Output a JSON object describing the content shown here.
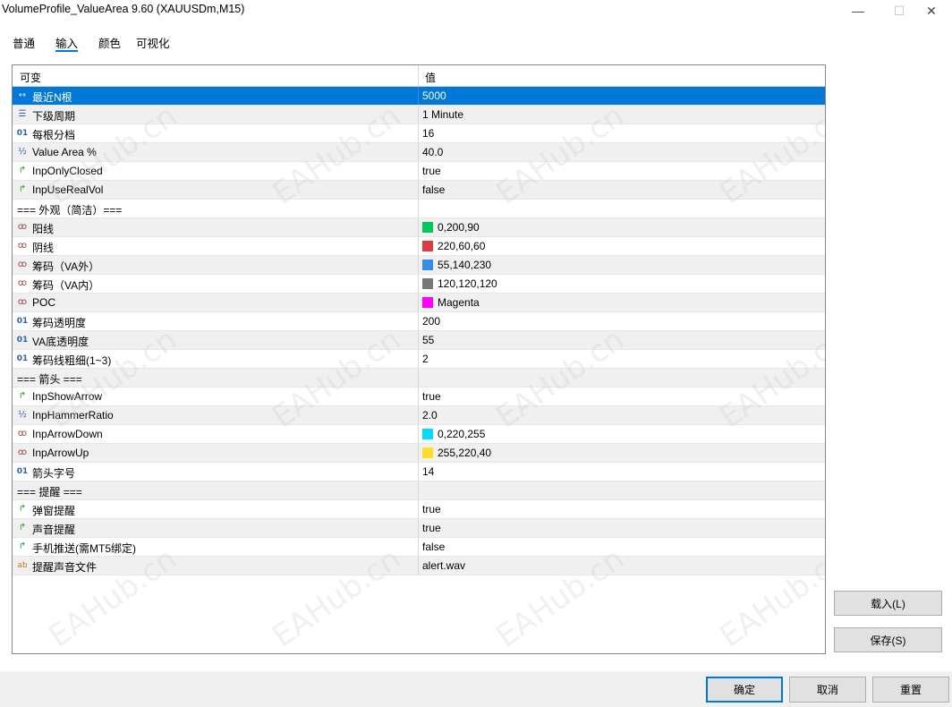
{
  "window": {
    "title": "VolumeProfile_ValueArea 9.60 (XAUUSDm,M15)",
    "min_glyph": "—",
    "max_glyph": "☐",
    "close_glyph": "✕"
  },
  "tabs": [
    {
      "label": "普通"
    },
    {
      "label": "输入",
      "active": true
    },
    {
      "label": "颜色"
    },
    {
      "label": "可视化"
    }
  ],
  "grid": {
    "col_variable": "可变",
    "col_value": "值",
    "rows": [
      {
        "icon": "ruler-icon",
        "glyph": "↔",
        "name": "最近N根",
        "value": "5000",
        "selected": true
      },
      {
        "icon": "enum-icon",
        "glyph": "☰",
        "name": "下级周期",
        "value": "1 Minute"
      },
      {
        "icon": "int-icon",
        "glyph": "01",
        "name": "每根分档",
        "value": "16"
      },
      {
        "icon": "double-icon",
        "glyph": "½",
        "name": "Value Area %",
        "value": "40.0"
      },
      {
        "icon": "bool-icon",
        "glyph": "↱",
        "name": "InpOnlyClosed",
        "value": "true"
      },
      {
        "icon": "bool-icon",
        "glyph": "↱",
        "name": "InpUseRealVol",
        "value": "false"
      },
      {
        "section": true,
        "name": "=== 外观（简洁）===",
        "value": ""
      },
      {
        "icon": "color-icon",
        "glyph": "ꝏ",
        "name": "阳线",
        "value": "0,200,90",
        "swatch": "#00c85a"
      },
      {
        "icon": "color-icon",
        "glyph": "ꝏ",
        "name": "阴线",
        "value": "220,60,60",
        "swatch": "#dc3c3c"
      },
      {
        "icon": "color-icon",
        "glyph": "ꝏ",
        "name": "筹码（VA外）",
        "value": "55,140,230",
        "swatch": "#378ce6"
      },
      {
        "icon": "color-icon",
        "glyph": "ꝏ",
        "name": "筹码（VA内）",
        "value": "120,120,120",
        "swatch": "#787878"
      },
      {
        "icon": "color-icon",
        "glyph": "ꝏ",
        "name": "POC",
        "value": "Magenta",
        "swatch": "#ff00ff"
      },
      {
        "icon": "int-icon",
        "glyph": "01",
        "name": "筹码透明度",
        "value": "200"
      },
      {
        "icon": "int-icon",
        "glyph": "01",
        "name": "VA底透明度",
        "value": "55"
      },
      {
        "icon": "int-icon",
        "glyph": "01",
        "name": "筹码线粗细(1~3)",
        "value": "2"
      },
      {
        "section": true,
        "name": "=== 箭头 ===",
        "value": ""
      },
      {
        "icon": "bool-icon",
        "glyph": "↱",
        "name": "InpShowArrow",
        "value": "true"
      },
      {
        "icon": "double-icon",
        "glyph": "½",
        "name": "InpHammerRatio",
        "value": "2.0"
      },
      {
        "icon": "color-icon",
        "glyph": "ꝏ",
        "name": "InpArrowDown",
        "value": "0,220,255",
        "swatch": "#00dcff"
      },
      {
        "icon": "color-icon",
        "glyph": "ꝏ",
        "name": "InpArrowUp",
        "value": "255,220,40",
        "swatch": "#ffdc28"
      },
      {
        "icon": "int-icon",
        "glyph": "01",
        "name": "箭头字号",
        "value": "14"
      },
      {
        "section": true,
        "name": "=== 提醒 ===",
        "value": ""
      },
      {
        "icon": "bool-icon",
        "glyph": "↱",
        "name": "弹窗提醒",
        "value": "true"
      },
      {
        "icon": "bool-icon",
        "glyph": "↱",
        "name": "声音提醒",
        "value": "true"
      },
      {
        "icon": "bool-icon",
        "glyph": "↱",
        "name": "手机推送(需MT5绑定)",
        "value": "false"
      },
      {
        "icon": "string-icon",
        "glyph": "ab",
        "name": "提醒声音文件",
        "value": "alert.wav"
      }
    ]
  },
  "watermark_text": "EAHub.cn",
  "buttons": {
    "load": "载入(L)",
    "save": "保存(S)",
    "ok": "确定",
    "cancel": "取消",
    "reset": "重置"
  },
  "colors": {
    "accent": "#0078d7",
    "selected_row": "#0078d7"
  }
}
